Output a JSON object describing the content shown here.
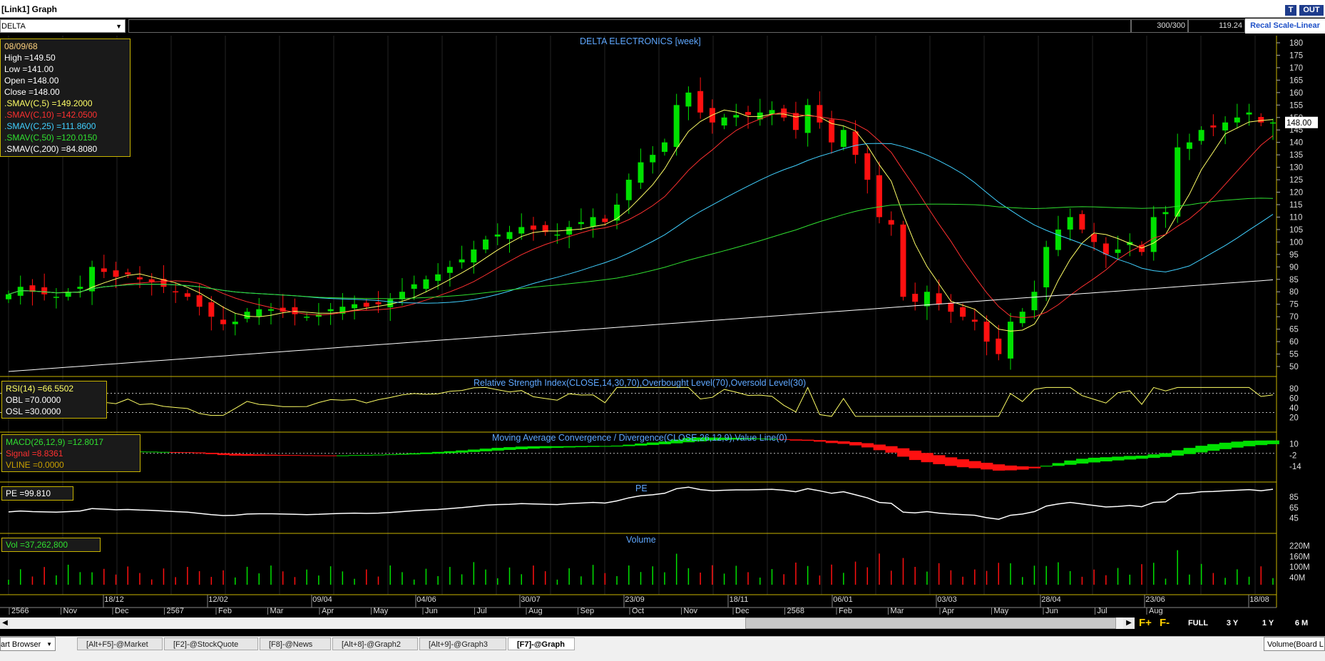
{
  "window": {
    "title": "[Link1] Graph",
    "btn_t": "T",
    "btn_out": "OUT"
  },
  "toolbar": {
    "symbol": "DELTA",
    "count": "300/300",
    "last_price": "119.24",
    "scale_button": "Recal Scale-Linear"
  },
  "main_pane": {
    "title": "DELTA ELECTRONICS [week]",
    "current_price_tag": "148.00",
    "legend": [
      {
        "text": "08/09/68",
        "color": "#ffd27f"
      },
      {
        "text": "High  =149.50",
        "color": "#ffffff"
      },
      {
        "text": "Low  =141.00",
        "color": "#ffffff"
      },
      {
        "text": "Open  =148.00",
        "color": "#ffffff"
      },
      {
        "text": "Close  =148.00",
        "color": "#ffffff"
      },
      {
        "text": ".SMAV(C,5)    =149.2000",
        "color": "#ffff66"
      },
      {
        "text": ".SMAV(C,10)   =142.0500",
        "color": "#ff3030"
      },
      {
        "text": ".SMAV(C,25)   =111.8600",
        "color": "#40d0ff"
      },
      {
        "text": ".SMAV(C,50)   =120.0150",
        "color": "#30e030"
      },
      {
        "text": ".SMAV(C,200)   =84.8080",
        "color": "#ffffff"
      }
    ],
    "y_ticks": [
      "180",
      "175",
      "170",
      "165",
      "160",
      "155",
      "150",
      "145",
      "140",
      "135",
      "130",
      "125",
      "120",
      "115",
      "110",
      "105",
      "100",
      "95",
      "90",
      "85",
      "80",
      "75",
      "70",
      "65",
      "60",
      "55",
      "50"
    ]
  },
  "rsi_pane": {
    "title": "Relative Strength Index(CLOSE,14,30,70),Overbought Level(70),Oversold Level(30)",
    "legend": [
      {
        "text": "RSI(14)    =66.5502",
        "color": "#ffff66"
      },
      {
        "text": "OBL   =70.0000",
        "color": "#ffffff"
      },
      {
        "text": "OSL   =30.0000",
        "color": "#ffffff"
      }
    ],
    "y_ticks": [
      "80",
      "60",
      "40",
      "20"
    ]
  },
  "macd_pane": {
    "title": "Moving Average Convergence / Divergence(CLOSE,26,12,9),Value Line(0)",
    "legend": [
      {
        "text": "MACD(26,12,9)    =12.8017",
        "color": "#30e030"
      },
      {
        "text": "Signal    =8.8361",
        "color": "#ff3030"
      },
      {
        "text": "VLINE    =0.0000",
        "color": "#c8a000"
      }
    ],
    "y_ticks": [
      "10",
      "-2",
      "-14"
    ]
  },
  "pe_pane": {
    "title": "PE",
    "legend": [
      {
        "text": "PE   =99.810",
        "color": "#ffffff"
      }
    ],
    "y_ticks": [
      "85",
      "65",
      "45"
    ]
  },
  "volume_pane": {
    "title": "Volume",
    "legend": [
      {
        "text": "Vol    =37,262,800",
        "color": "#30e030"
      }
    ],
    "y_ticks": [
      "220M",
      "160M",
      "100M",
      "40M"
    ]
  },
  "x_axis": {
    "date_labels": [
      "18/12",
      "12/02",
      "09/04",
      "04/06",
      "30/07",
      "23/09",
      "18/11",
      "06/01",
      "03/03",
      "28/04",
      "23/06",
      "18/08"
    ],
    "month_labels": [
      "2566",
      "Nov",
      "Dec",
      "2567",
      "Feb",
      "Mar",
      "Apr",
      "May",
      "Jun",
      "Jul",
      "Aug",
      "Sep",
      "Oct",
      "Nov",
      "Dec",
      "2568",
      "Feb",
      "Mar",
      "Apr",
      "May",
      "Jun",
      "Jul",
      "Aug"
    ]
  },
  "period_buttons": [
    "FULL",
    "3 Y",
    "1 Y",
    "6 M"
  ],
  "f_buttons": [
    "F+",
    "F-"
  ],
  "taskbar": {
    "browser_label": "art Browser",
    "tabs": [
      "[Alt+F5]-@Market",
      "[F2]-@StockQuote",
      "[F8]-@News",
      "[Alt+8]-@Graph2",
      "[Alt+9]-@Graph3",
      "[F7]-@Graph"
    ],
    "active_tab": 5,
    "right_label": "Volume(Board L"
  },
  "colors": {
    "up": "#00e000",
    "down": "#ff1010",
    "sma5": "#ffff66",
    "sma10": "#ff3030",
    "sma25": "#40d0ff",
    "sma50": "#30e030",
    "sma200": "#ffffff",
    "pane_border": "#c8b400",
    "title": "#5fa8ff"
  },
  "chart_data": {
    "type": "candlestick",
    "title": "DELTA ELECTRONICS [week]",
    "x_range": [
      "2023-10 (2566)",
      "2025-09 (2568)"
    ],
    "ylim": [
      45,
      182
    ],
    "last_candle": {
      "date": "08/09/68",
      "open": 148.0,
      "high": 149.5,
      "low": 141.0,
      "close": 148.0
    },
    "closes_approx": [
      79,
      82,
      80,
      79,
      78,
      80,
      82,
      90,
      88,
      86,
      87,
      85,
      84,
      82,
      80,
      78,
      74,
      70,
      67,
      68,
      72,
      73,
      73,
      72,
      71,
      70,
      71,
      73,
      74,
      75,
      74,
      75,
      77,
      80,
      83,
      85,
      87,
      90,
      93,
      97,
      101,
      103,
      104,
      106,
      105,
      104,
      103,
      106,
      108,
      110,
      108,
      115,
      125,
      132,
      135,
      140,
      155,
      160,
      152,
      148,
      150,
      151,
      151,
      152,
      153,
      150,
      145,
      155,
      148,
      140,
      145,
      135,
      125,
      110,
      107,
      78,
      76,
      80,
      75,
      72,
      70,
      68,
      60,
      55,
      68,
      72,
      80,
      98,
      105,
      110,
      105,
      100,
      95,
      97,
      100,
      96,
      110,
      112,
      138,
      140,
      145,
      146,
      148,
      150,
      152,
      148,
      148
    ],
    "sma_final": {
      "SMAV(C,5)": 149.2,
      "SMAV(C,10)": 142.05,
      "SMAV(C,25)": 111.86,
      "SMAV(C,50)": 120.015,
      "SMAV(C,200)": 84.808
    },
    "rsi": {
      "ylim": [
        10,
        90
      ],
      "overbought": 70,
      "oversold": 30,
      "last": 66.5502
    },
    "macd": {
      "ylim": [
        -20,
        15
      ],
      "macd_last": 12.8017,
      "signal_last": 8.8361,
      "value_line": 0
    },
    "pe": {
      "ylim": [
        35,
        100
      ],
      "last": 99.81
    },
    "volume": {
      "ylim": [
        0,
        250000000
      ],
      "last": 37262800
    }
  }
}
